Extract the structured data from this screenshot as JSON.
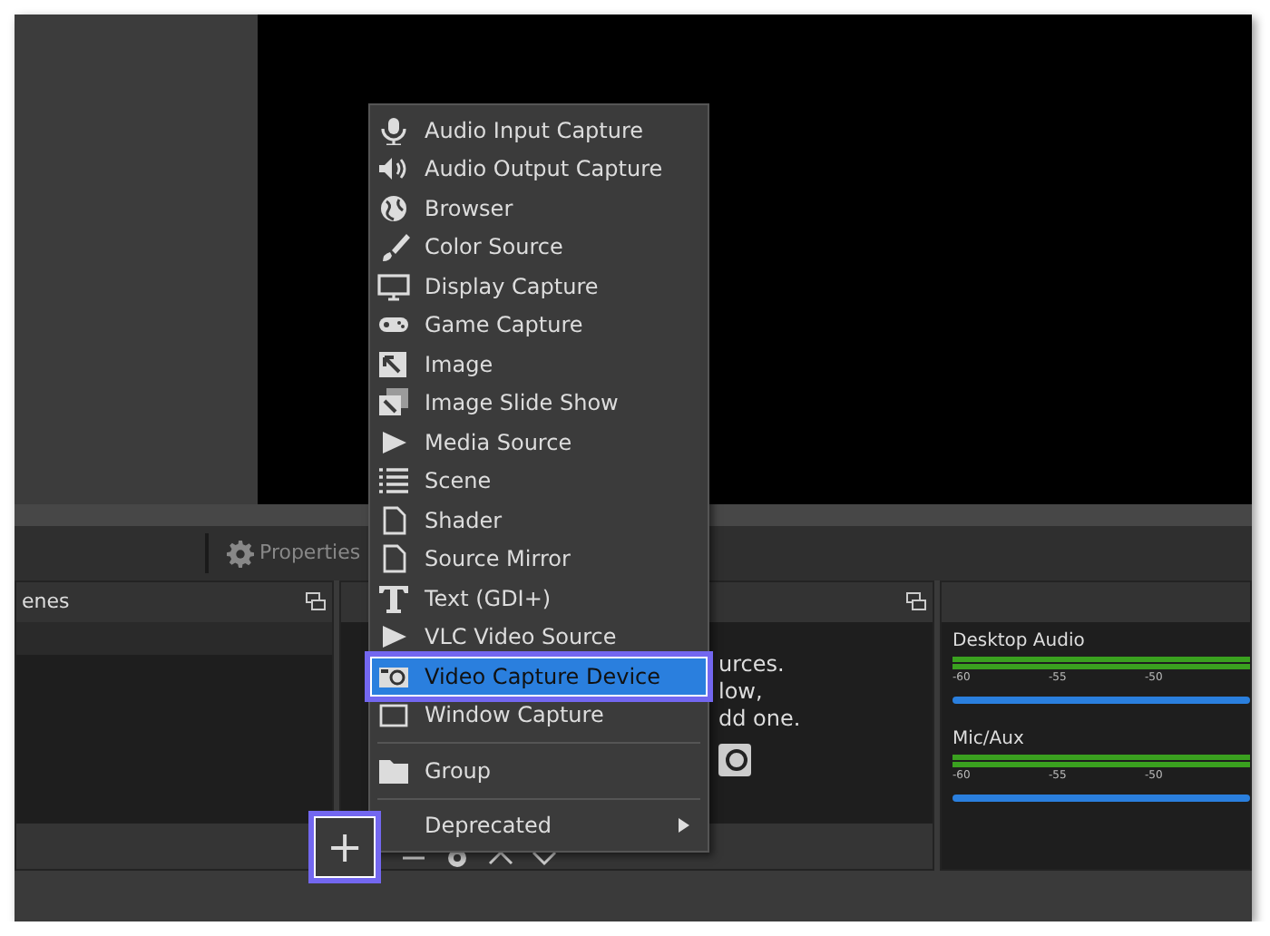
{
  "toolbar": {
    "properties_button": {
      "label": "Properties",
      "disabled": true
    }
  },
  "scenes_dock": {
    "title": "enes"
  },
  "sources_dock": {
    "hint_lines": [
      "urces.",
      "low,",
      "dd one."
    ],
    "add_button": {
      "label": "+",
      "annotated": true
    }
  },
  "audio_mixer": {
    "channels": [
      {
        "name": "Desktop Audio",
        "level": 1,
        "ticks": [
          "-60",
          "-55",
          "-50"
        ]
      },
      {
        "name": "Mic/Aux",
        "level": 1,
        "ticks": [
          "-60",
          "-55",
          "-50"
        ]
      }
    ]
  },
  "context_menu": {
    "items": [
      {
        "kind": "item",
        "label": "Audio Input Capture",
        "selected": false,
        "annotated": false
      },
      {
        "kind": "item",
        "label": "Audio Output Capture",
        "selected": false,
        "annotated": false
      },
      {
        "kind": "item",
        "label": "Browser",
        "selected": false,
        "annotated": false
      },
      {
        "kind": "item",
        "label": "Color Source",
        "selected": false,
        "annotated": false
      },
      {
        "kind": "item",
        "label": "Display Capture",
        "selected": false,
        "annotated": false
      },
      {
        "kind": "item",
        "label": "Game Capture",
        "selected": false,
        "annotated": false
      },
      {
        "kind": "item",
        "label": "Image",
        "selected": false,
        "annotated": false
      },
      {
        "kind": "item",
        "label": "Image Slide Show",
        "selected": false,
        "annotated": false
      },
      {
        "kind": "item",
        "label": "Media Source",
        "selected": false,
        "annotated": false
      },
      {
        "kind": "item",
        "label": "Scene",
        "selected": false,
        "annotated": false
      },
      {
        "kind": "item",
        "label": "Shader",
        "selected": false,
        "annotated": false
      },
      {
        "kind": "item",
        "label": "Source Mirror",
        "selected": false,
        "annotated": false
      },
      {
        "kind": "item",
        "label": "Text (GDI+)",
        "selected": false,
        "annotated": false
      },
      {
        "kind": "item",
        "label": "VLC Video Source",
        "selected": false,
        "annotated": false
      },
      {
        "kind": "item",
        "label": "Video Capture Device",
        "selected": true,
        "annotated": true
      },
      {
        "kind": "item",
        "label": "Window Capture",
        "selected": false,
        "annotated": false
      },
      {
        "kind": "separator"
      },
      {
        "kind": "item",
        "label": "Group",
        "selected": false,
        "annotated": false
      },
      {
        "kind": "separator"
      },
      {
        "kind": "submenu",
        "label": "Deprecated",
        "selected": false,
        "annotated": false
      }
    ]
  }
}
